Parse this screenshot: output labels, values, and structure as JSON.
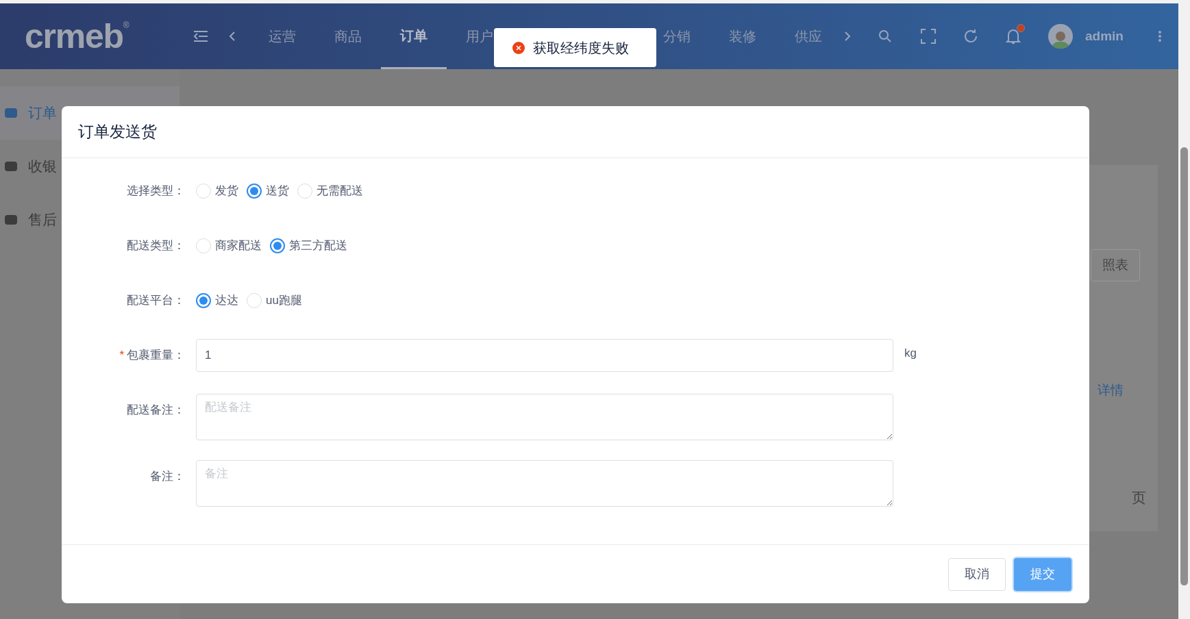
{
  "header": {
    "logo": "crmeb",
    "logo_mark": "®",
    "nav": [
      {
        "label": "运营",
        "selected": false
      },
      {
        "label": "商品",
        "selected": false
      },
      {
        "label": "订单",
        "selected": true
      },
      {
        "label": "用户",
        "selected": false
      },
      {
        "label": "分销",
        "selected": false
      },
      {
        "label": "装修",
        "selected": false
      },
      {
        "label": "供应",
        "selected": false
      }
    ],
    "user": "admin",
    "notification": true
  },
  "sidebar": {
    "items": [
      {
        "label": "订单",
        "selected": true
      },
      {
        "label": "收银",
        "selected": false
      },
      {
        "label": "售后",
        "selected": false
      }
    ]
  },
  "background_page": {
    "button_1": "照表",
    "link": "详情",
    "pager_unit": "页"
  },
  "toast": {
    "kind": "error",
    "message": "获取经纬度失败"
  },
  "dialog": {
    "title": "订单发送货",
    "fields": [
      {
        "kind": "radio",
        "label": "选择类型：",
        "options": [
          {
            "label": "发货",
            "selected": false
          },
          {
            "label": "送货",
            "selected": true
          },
          {
            "label": "无需配送",
            "selected": false
          }
        ]
      },
      {
        "kind": "radio",
        "label": "配送类型：",
        "options": [
          {
            "label": "商家配送",
            "selected": false
          },
          {
            "label": "第三方配送",
            "selected": true
          }
        ]
      },
      {
        "kind": "radio",
        "label": "配送平台：",
        "options": [
          {
            "label": "达达",
            "selected": true
          },
          {
            "label": "uu跑腿",
            "selected": false
          }
        ]
      },
      {
        "kind": "input",
        "label": "包裹重量：",
        "required_mark": "*",
        "value": "1",
        "suffix": "kg"
      },
      {
        "kind": "textarea",
        "label": "配送备注：",
        "placeholder": "配送备注"
      },
      {
        "kind": "textarea",
        "label": "备注：",
        "placeholder": "备注"
      }
    ],
    "buttons": [
      {
        "label": "取消",
        "primary": false
      },
      {
        "label": "提交",
        "primary": true
      }
    ]
  }
}
